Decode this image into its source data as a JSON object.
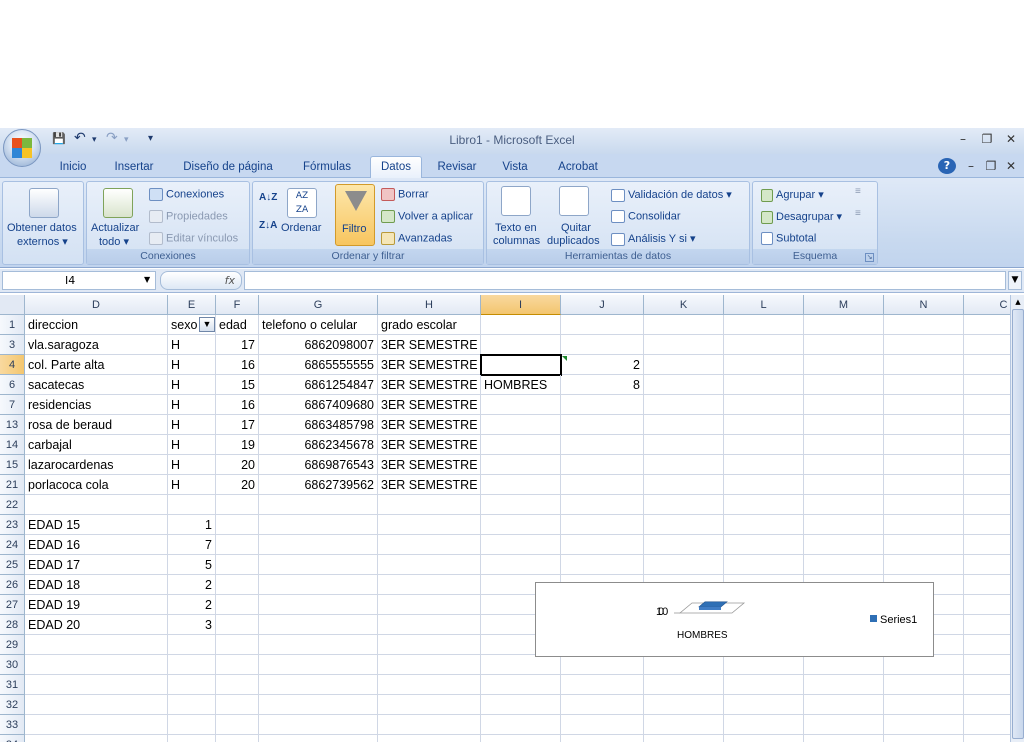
{
  "window": {
    "title": "Libro1 - Microsoft Excel"
  },
  "qat": {
    "save": "💾",
    "undo": "↶",
    "redo": "↷",
    "custom": "▾"
  },
  "tabs": [
    "Inicio",
    "Insertar",
    "Diseño de página",
    "Fórmulas",
    "Datos",
    "Revisar",
    "Vista",
    "Acrobat"
  ],
  "active_tab": "Datos",
  "ribbon": {
    "obtener": {
      "line1": "Obtener datos",
      "line2": "externos ▾"
    },
    "actualizar": {
      "line1": "Actualizar",
      "line2": "todo ▾"
    },
    "conexiones": "Conexiones",
    "propiedades": "Propiedades",
    "editar_vinculos": "Editar vínculos",
    "group_conexiones": "Conexiones",
    "ordenar": "Ordenar",
    "filtro": "Filtro",
    "borrar": "Borrar",
    "volver": "Volver a aplicar",
    "avanzadas": "Avanzadas",
    "group_ordenar": "Ordenar y filtrar",
    "texto_col": {
      "line1": "Texto en",
      "line2": "columnas"
    },
    "quitar_dup": {
      "line1": "Quitar",
      "line2": "duplicados"
    },
    "validacion": "Validación de datos ▾",
    "consolidar": "Consolidar",
    "analisis": "Análisis Y si ▾",
    "group_herramientas": "Herramientas de datos",
    "agrupar": "Agrupar ▾",
    "desagrupar": "Desagrupar ▾",
    "subtotal": "Subtotal",
    "group_esquema": "Esquema",
    "colors": {
      "accent": "#15428b",
      "filtro_active": "#f7c55f"
    }
  },
  "formula_bar": {
    "name_box": "I4",
    "fx": "fx",
    "value": ""
  },
  "columns": [
    "D",
    "E",
    "F",
    "G",
    "H",
    "I",
    "J",
    "K",
    "L",
    "M",
    "N",
    "C"
  ],
  "selected_column": "I",
  "rows": [
    {
      "num": "1",
      "cells": {
        "D": "direccion",
        "E": "sexo",
        "F": "edad",
        "G": "telefono o celular",
        "H": "grado escolar"
      }
    },
    {
      "num": "3",
      "cells": {
        "D": "vla.saragoza",
        "E": "H",
        "F": "17",
        "G": "6862098007",
        "H": "3ER SEMESTRE"
      }
    },
    {
      "num": "4",
      "cells": {
        "D": "col. Parte alta",
        "E": "H",
        "F": "16",
        "G": "6865555555",
        "H": "3ER SEMESTRE",
        "J": "2"
      }
    },
    {
      "num": "6",
      "cells": {
        "D": "sacatecas",
        "E": "H",
        "F": "15",
        "G": "6861254847",
        "H": "3ER SEMESTRE",
        "I": "HOMBRES",
        "J": "8"
      }
    },
    {
      "num": "7",
      "cells": {
        "D": "residencias",
        "E": "H",
        "F": "16",
        "G": "6867409680",
        "H": "3ER SEMESTRE"
      }
    },
    {
      "num": "13",
      "cells": {
        "D": "rosa de beraud",
        "E": "H",
        "F": "17",
        "G": "6863485798",
        "H": "3ER SEMESTRE"
      }
    },
    {
      "num": "14",
      "cells": {
        "D": "carbajal",
        "E": "H",
        "F": "19",
        "G": "6862345678",
        "H": "3ER SEMESTRE"
      }
    },
    {
      "num": "15",
      "cells": {
        "D": "lazarocardenas",
        "E": "H",
        "F": "20",
        "G": "6869876543",
        "H": "3ER SEMESTRE"
      }
    },
    {
      "num": "21",
      "cells": {
        "D": "porlacoca cola",
        "E": "H",
        "F": "20",
        "G": "6862739562",
        "H": "3ER SEMESTRE"
      }
    },
    {
      "num": "22",
      "cells": {}
    },
    {
      "num": "23",
      "cells": {
        "D": "EDAD 15",
        "E": "1"
      }
    },
    {
      "num": "24",
      "cells": {
        "D": "EDAD 16",
        "E": "7"
      }
    },
    {
      "num": "25",
      "cells": {
        "D": "EDAD 17",
        "E": "5"
      }
    },
    {
      "num": "26",
      "cells": {
        "D": "EDAD 18",
        "E": "2"
      }
    },
    {
      "num": "27",
      "cells": {
        "D": "EDAD 19",
        "E": "2"
      }
    },
    {
      "num": "28",
      "cells": {
        "D": "EDAD 20",
        "E": "3"
      }
    },
    {
      "num": "29",
      "cells": {}
    },
    {
      "num": "30",
      "cells": {}
    },
    {
      "num": "31",
      "cells": {}
    },
    {
      "num": "32",
      "cells": {}
    },
    {
      "num": "33",
      "cells": {}
    },
    {
      "num": "34",
      "cells": {}
    }
  ],
  "selected_cell": {
    "col": "I",
    "row": "4"
  },
  "chart_data": {
    "type": "bar",
    "categories": [
      "HOMBRES"
    ],
    "series": [
      {
        "name": "Series1",
        "values": [
          8
        ],
        "color": "#2e6fb5"
      }
    ],
    "axis_labels": [
      "10",
      "0"
    ],
    "title": "",
    "legend": "right"
  }
}
